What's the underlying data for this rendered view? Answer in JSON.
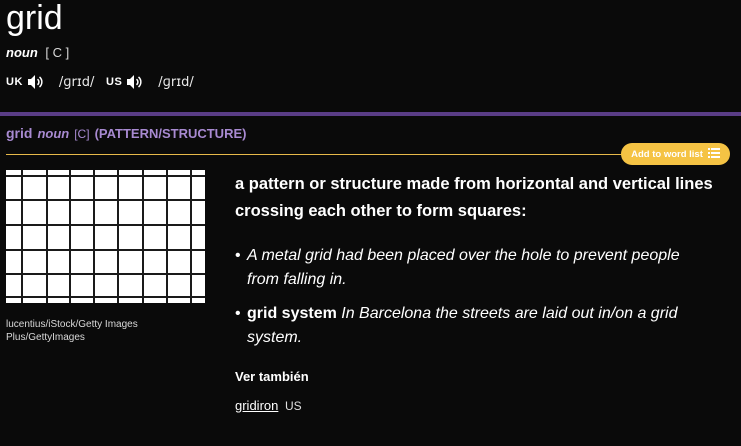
{
  "entry": {
    "headword": "grid",
    "pos": "noun",
    "grammar": "[ C ]",
    "pronunciations": [
      {
        "region": "UK",
        "ipa": "/ɡrɪd/"
      },
      {
        "region": "US",
        "ipa": "/ɡrɪd/"
      }
    ]
  },
  "sense": {
    "headword": "grid",
    "pos": "noun",
    "grammar": "[C]",
    "guideword": "(PATTERN/STRUCTURE)",
    "add_to_list_label": "Add to word list",
    "definition": "a pattern or structure made from horizontal and vertical lines crossing each other to form squares:",
    "examples": [
      {
        "phrase": "",
        "text": "A metal grid had been placed over the hole to prevent people from falling in."
      },
      {
        "phrase": "grid system",
        "text": "In Barcelona the streets are laid out in/on a grid system."
      }
    ],
    "image_caption": "lucentius/iStock/Getty Images Plus/GettyImages",
    "see_also_label": "Ver también",
    "see_also": {
      "word": "gridiron",
      "label": "US"
    }
  },
  "colors": {
    "background": "#0a0a0a",
    "sense_header": "#a88ad1",
    "divider_purple": "#5a3d86",
    "accent_gold": "#f5c344"
  }
}
